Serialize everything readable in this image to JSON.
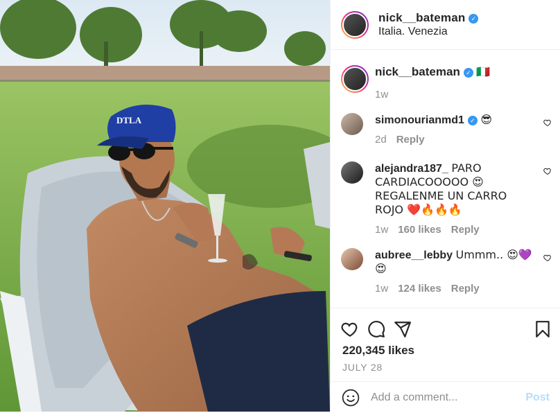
{
  "header": {
    "username": "nick__bateman",
    "location": "Italia. Venezia"
  },
  "caption": {
    "username": "nick__bateman",
    "flag": "🇮🇹",
    "time": "1w"
  },
  "comments": [
    {
      "username": "simonourianmd1",
      "text": "😎",
      "time": "2d",
      "likes": "",
      "reply": "Reply"
    },
    {
      "username": "alejandra187_",
      "text": "PARO CARDIACOOOOO 😍 REGALENME UN CARRO ROJO ❤️🔥🔥🔥",
      "time": "1w",
      "likes": "160 likes",
      "reply": "Reply"
    },
    {
      "username": "aubree__lebby",
      "text": "Ummm.. 😍💜😍",
      "time": "1w",
      "likes": "124 likes",
      "reply": "Reply"
    }
  ],
  "post": {
    "likes": "220,345 likes",
    "date": "JULY 28"
  },
  "composer": {
    "placeholder": "Add a comment...",
    "post_label": "Post"
  },
  "photo": {
    "cap_text": "DTLA"
  },
  "colors": {
    "verified": "#3897f0",
    "post_disabled": "#b2dffc",
    "muted": "#8e8e8e"
  }
}
